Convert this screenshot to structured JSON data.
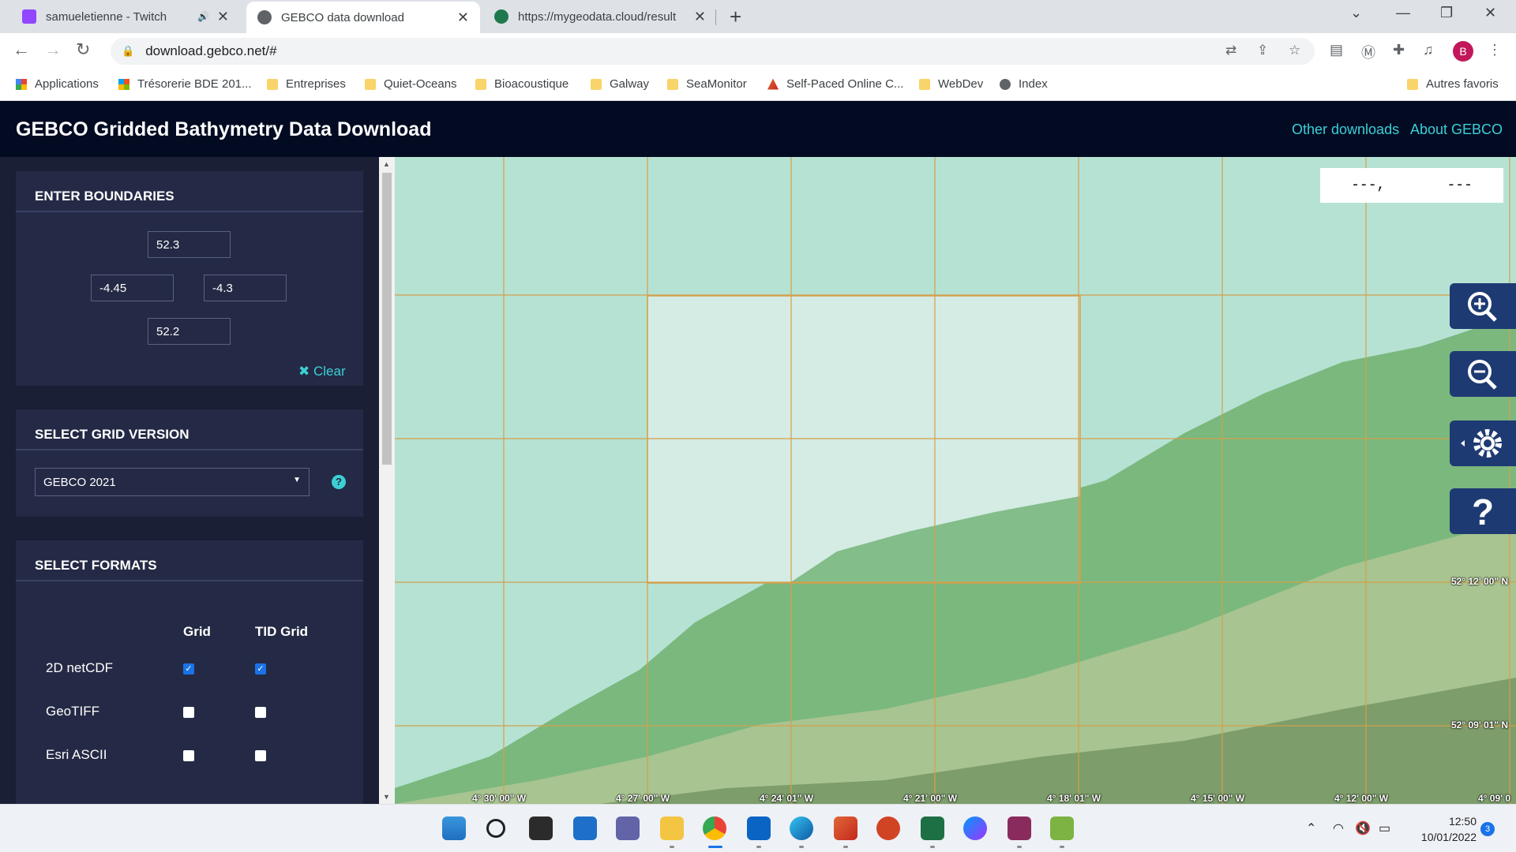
{
  "browser": {
    "tabs": [
      {
        "title": "samueletienne - Twitch",
        "favicon": "twitch-icon",
        "color": "#9146ff",
        "audio": true
      },
      {
        "title": "GEBCO data download",
        "favicon": "globe-icon",
        "color": "#5f6368",
        "active": true
      },
      {
        "title": "https://mygeodata.cloud/result",
        "favicon": "mygeodata-icon",
        "color": "#1e7a4c"
      }
    ],
    "url": "download.gebco.net/#",
    "bookmarks": [
      {
        "label": "Applications",
        "icon": "apps-grid-icon"
      },
      {
        "label": "Trésorerie BDE 201...",
        "icon": "microsoft-icon"
      },
      {
        "label": "Entreprises",
        "icon": "folder-icon"
      },
      {
        "label": "Quiet-Oceans",
        "icon": "folder-icon"
      },
      {
        "label": "Bioacoustique",
        "icon": "folder-icon"
      },
      {
        "label": "Galway",
        "icon": "folder-icon"
      },
      {
        "label": "SeaMonitor",
        "icon": "folder-icon"
      },
      {
        "label": "Self-Paced Online C...",
        "icon": "matlab-icon"
      },
      {
        "label": "WebDev",
        "icon": "folder-icon"
      },
      {
        "label": "Index",
        "icon": "globe-icon"
      }
    ],
    "other_bookmarks": "Autres favoris",
    "profile_initial": "B"
  },
  "app": {
    "title": "GEBCO Gridded Bathymetry Data Download",
    "links": [
      "Other downloads",
      "About GEBCO"
    ]
  },
  "boundaries": {
    "heading": "ENTER BOUNDARIES",
    "north": "52.3",
    "west": "-4.45",
    "east": "-4.3",
    "south": "52.2",
    "clear_label": "Clear"
  },
  "grid_version": {
    "heading": "SELECT GRID VERSION",
    "selected": "GEBCO 2021",
    "help": "?"
  },
  "formats": {
    "heading": "SELECT FORMATS",
    "columns": [
      "Grid",
      "TID Grid"
    ],
    "rows": [
      {
        "label": "2D netCDF",
        "grid": true,
        "tid": true
      },
      {
        "label": "GeoTIFF",
        "grid": false,
        "tid": false
      },
      {
        "label": "Esri ASCII",
        "grid": false,
        "tid": false
      }
    ]
  },
  "map": {
    "coord_readout": {
      "lat": "---,",
      "lon": "---"
    },
    "lat_labels": [
      "52° 12' 00\" N",
      "52° 09' 01\" N"
    ],
    "lon_labels": [
      "4° 30' 00\" W",
      "4° 27' 00\" W",
      "4° 24' 01\" W",
      "4° 21' 00\" W",
      "4° 18' 01\" W",
      "4° 15' 00\" W",
      "4° 12' 00\" W",
      "4° 09' 0"
    ],
    "colors": {
      "sea": "#b6e2d4",
      "selection": "#d4ece4",
      "land": "#7ab87e",
      "grid_line": "#d4a04a"
    }
  },
  "taskbar": {
    "time": "12:50",
    "date": "10/01/2022",
    "notifications": "3"
  }
}
